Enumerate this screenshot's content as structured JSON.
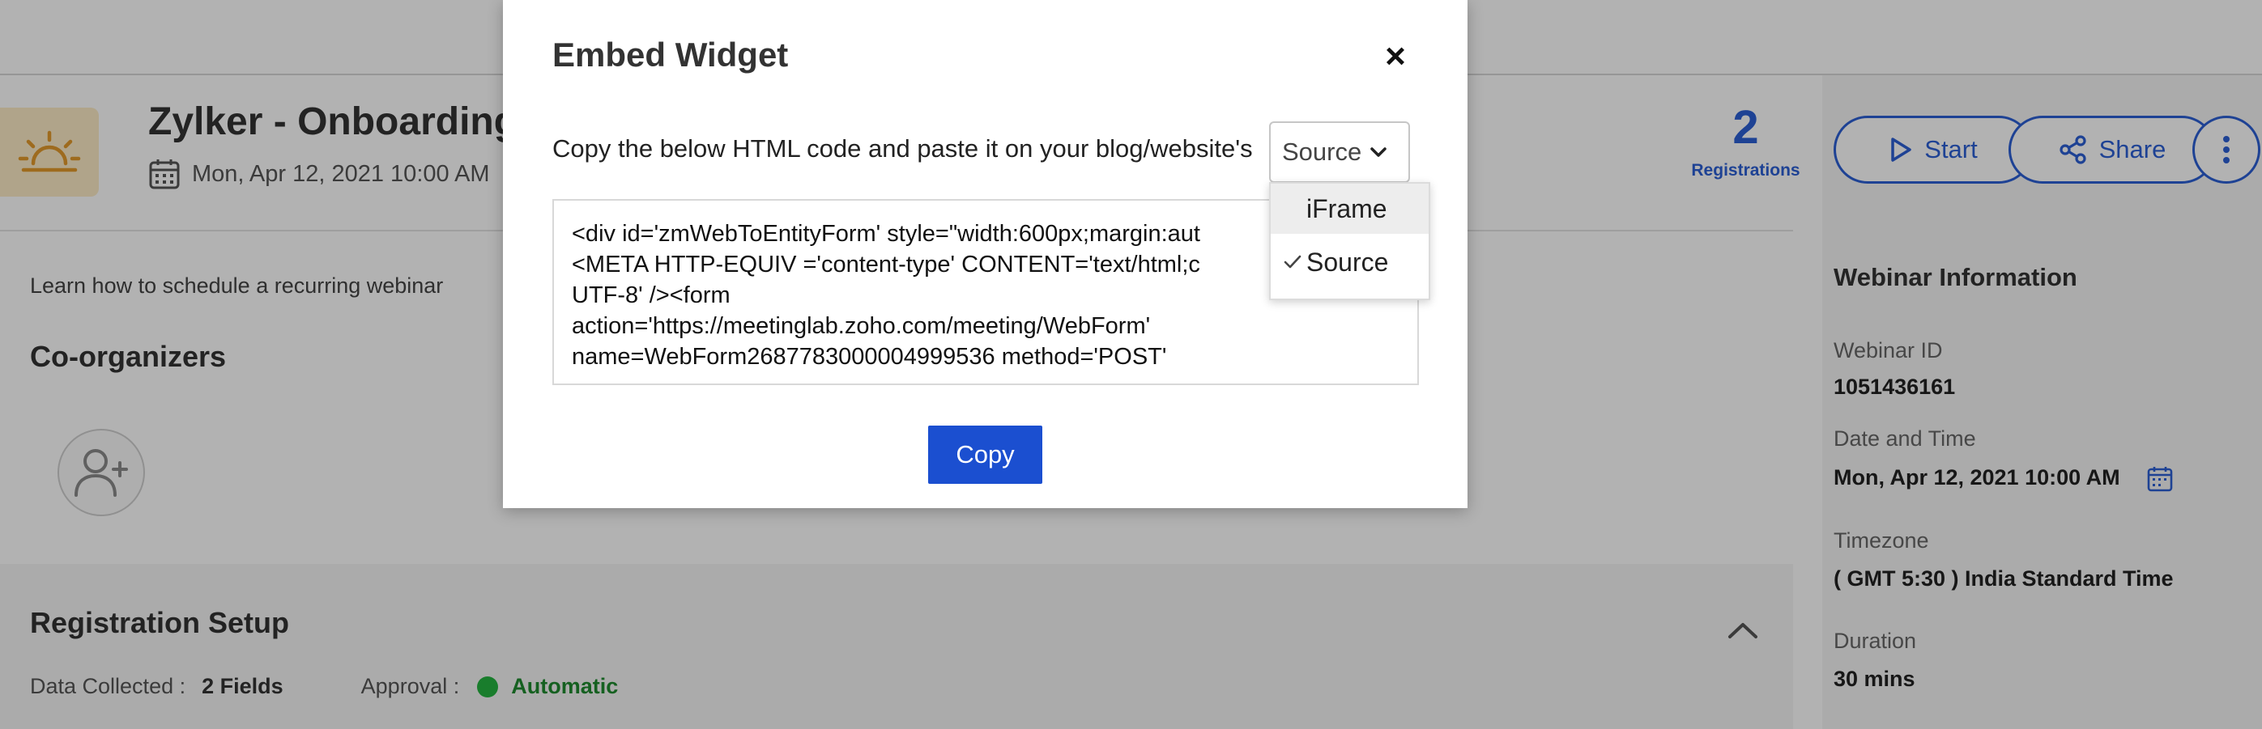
{
  "event": {
    "title": "Zylker - Onboarding W",
    "date": "Mon, Apr 12, 2021 10:00 AM",
    "description": "Learn how to schedule a recurring webinar"
  },
  "registrations": {
    "count": "2",
    "label": "Registrations"
  },
  "actions": {
    "start": "Start",
    "share": "Share"
  },
  "co_organizers": {
    "title": "Co-organizers"
  },
  "registration_setup": {
    "title": "Registration Setup",
    "data_collected_label": "Data Collected :",
    "data_collected_value": "2 Fields",
    "approval_label": "Approval :",
    "approval_value": "Automatic"
  },
  "webinar_info": {
    "title": "Webinar Information",
    "id_label": "Webinar ID",
    "id_value": "1051436161",
    "datetime_label": "Date and Time",
    "datetime_value": "Mon, Apr 12, 2021 10:00 AM",
    "timezone_label": "Timezone",
    "timezone_value": "( GMT 5:30 ) India Standard Time",
    "duration_label": "Duration",
    "duration_value": "30 mins"
  },
  "modal": {
    "title": "Embed Widget",
    "close": "×",
    "instruction": "Copy the below HTML code and paste it on your blog/website's",
    "selected_format": "Source",
    "code": "<div id='zmWebToEntityForm' style=\"width:600px;margin:aut\n<META HTTP-EQUIV ='content-type' CONTENT='text/html;c\nUTF-8' /><form\naction='https://meetinglab.zoho.com/meeting/WebForm'\nname=WebForm2687783000004999536 method='POST'",
    "copy_button": "Copy",
    "options": [
      {
        "label": "iFrame",
        "checked": false
      },
      {
        "label": "Source",
        "checked": true
      }
    ]
  },
  "colors": {
    "accent": "#2c5fd4",
    "copy_button": "#1b4fd0",
    "approval_dot": "#25b33f",
    "logo_bg": "#fcebc6"
  }
}
